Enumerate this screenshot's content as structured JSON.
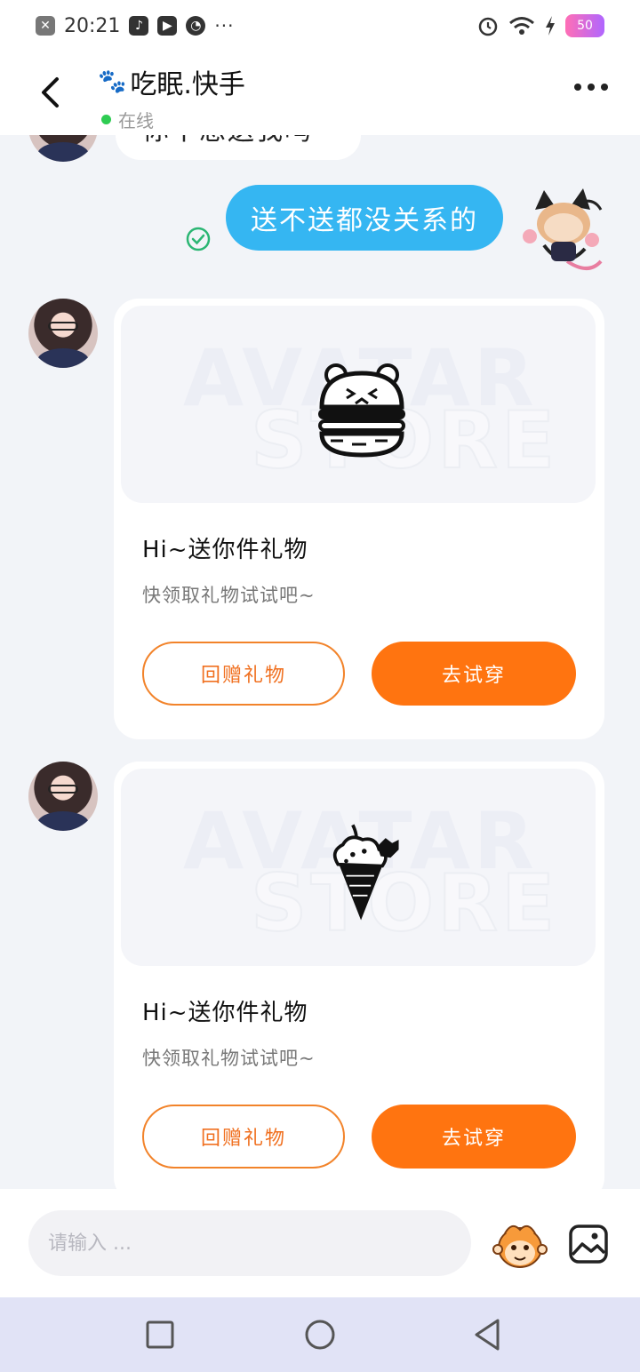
{
  "status_bar": {
    "time": "20:21",
    "dots": "···",
    "battery": "50"
  },
  "header": {
    "title": "吃眠.快手",
    "status": "在线"
  },
  "messages": {
    "partial_text": "你不想送我吗",
    "my_message": "送不送都没关系的",
    "watermark_line1": "AVATAR",
    "watermark_line2": "STORE"
  },
  "gift_cards": [
    {
      "item": "burger-icon",
      "title": "Hi~送你件礼物",
      "subtitle": "快领取礼物试试吧~",
      "return_label": "回赠礼物",
      "try_label": "去试穿"
    },
    {
      "item": "ice-cream-icon",
      "title": "Hi~送你件礼物",
      "subtitle": "快领取礼物试试吧~",
      "return_label": "回赠礼物",
      "try_label": "去试穿"
    }
  ],
  "input": {
    "placeholder": "请输入 ..."
  },
  "colors": {
    "accent_orange": "#ff7410",
    "bubble_blue": "#35b6f2",
    "online_green": "#2ecc52"
  }
}
